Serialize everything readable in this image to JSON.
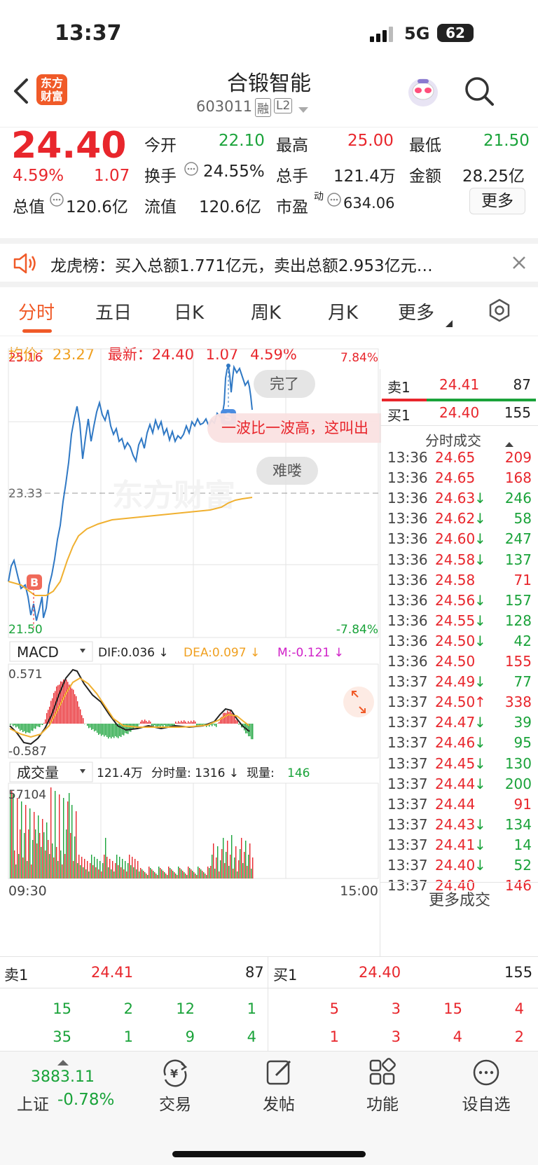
{
  "status": {
    "time": "13:37",
    "network": "5G",
    "battery": "62"
  },
  "header": {
    "title": "合锻智能",
    "code": "603011",
    "badge_margin": "融",
    "badge_level": "L2",
    "logo": "东方财富"
  },
  "quote": {
    "price": "24.40",
    "change_pct": "4.59%",
    "change": "1.07",
    "open_label": "今开",
    "open": "22.10",
    "high_label": "最高",
    "high": "25.00",
    "low_label": "最低",
    "low": "21.50",
    "turnover_label": "换手",
    "turnover": "24.55%",
    "volume_label": "总手",
    "volume": "121.4万",
    "amount_label": "金额",
    "amount": "28.25亿",
    "mcap_label": "总值",
    "mcap": "120.6亿",
    "float_label": "流值",
    "float": "120.6亿",
    "pe_label": "市盈",
    "pe_sup": "动",
    "pe": "634.06",
    "more": "更多"
  },
  "banner": {
    "text": "龙虎榜：买入总额1.771亿元，卖出总额2.953亿元…"
  },
  "tabs": [
    "分时",
    "五日",
    "日K",
    "周K",
    "月K",
    "更多"
  ],
  "chart": {
    "avg_label": "均价：",
    "avg": "23.27",
    "latest_label": "最新：",
    "latest": "24.40",
    "chg": "1.07",
    "pct": "4.59%",
    "y_top": "25.16",
    "y_mid": "23.33",
    "y_bot": "21.50",
    "pct_top": "7.84%",
    "pct_bot": "-7.84%",
    "start": "09:30",
    "end": "15:00",
    "bubble_1": "完了",
    "bubble_2": "一波比一波高，这叫出",
    "bubble_3": "难喽",
    "watermark": "东方财富",
    "macd_label": "MACD",
    "dif": "DIF:0.036 ↓",
    "dea": "DEA:0.097 ↓",
    "m": "M:-0.121 ↓",
    "macd_top": "0.571",
    "macd_bot": "-0.587",
    "vol_label": "成交量",
    "vol_total": "121.4万",
    "vol_min": "分时量: 1316 ↓",
    "vol_now_label": "现量:",
    "vol_now": "146",
    "vol_top": "57104"
  },
  "book_top": {
    "ask_label": "卖1",
    "ask": "24.41",
    "ask_vol": "87",
    "bid_label": "买1",
    "bid": "24.40",
    "bid_vol": "155"
  },
  "ticks_title": "分时成交",
  "ticks": [
    {
      "t": "13:36",
      "p": "24.65",
      "v": "209",
      "d": ""
    },
    {
      "t": "13:36",
      "p": "24.65",
      "v": "168",
      "d": ""
    },
    {
      "t": "13:36",
      "p": "24.63",
      "v": "246",
      "d": "↓"
    },
    {
      "t": "13:36",
      "p": "24.62",
      "v": "58",
      "d": "↓"
    },
    {
      "t": "13:36",
      "p": "24.60",
      "v": "247",
      "d": "↓"
    },
    {
      "t": "13:36",
      "p": "24.58",
      "v": "137",
      "d": "↓"
    },
    {
      "t": "13:36",
      "p": "24.58",
      "v": "71",
      "d": ""
    },
    {
      "t": "13:36",
      "p": "24.56",
      "v": "157",
      "d": "↓"
    },
    {
      "t": "13:36",
      "p": "24.55",
      "v": "128",
      "d": "↓"
    },
    {
      "t": "13:36",
      "p": "24.50",
      "v": "42",
      "d": "↓"
    },
    {
      "t": "13:36",
      "p": "24.50",
      "v": "155",
      "d": ""
    },
    {
      "t": "13:37",
      "p": "24.49",
      "v": "77",
      "d": "↓"
    },
    {
      "t": "13:37",
      "p": "24.50",
      "v": "338",
      "d": "↑"
    },
    {
      "t": "13:37",
      "p": "24.47",
      "v": "39",
      "d": "↓"
    },
    {
      "t": "13:37",
      "p": "24.46",
      "v": "95",
      "d": "↓"
    },
    {
      "t": "13:37",
      "p": "24.45",
      "v": "130",
      "d": "↓"
    },
    {
      "t": "13:37",
      "p": "24.44",
      "v": "200",
      "d": "↓"
    },
    {
      "t": "13:37",
      "p": "24.44",
      "v": "91",
      "d": ""
    },
    {
      "t": "13:37",
      "p": "24.43",
      "v": "134",
      "d": "↓"
    },
    {
      "t": "13:37",
      "p": "24.41",
      "v": "14",
      "d": "↓"
    },
    {
      "t": "13:37",
      "p": "24.40",
      "v": "52",
      "d": "↓"
    },
    {
      "t": "13:37",
      "p": "24.40",
      "v": "146",
      "d": ""
    }
  ],
  "more_ticks": "更多成交",
  "book": {
    "ask_label": "卖1",
    "ask": "24.41",
    "ask_vol": "87",
    "bid_label": "买1",
    "bid": "24.40",
    "bid_vol": "155",
    "ask_row1": [
      "15",
      "2",
      "12",
      "1"
    ],
    "ask_row2": [
      "35",
      "1",
      "9",
      "4"
    ],
    "bid_row1": [
      "5",
      "3",
      "15",
      "4"
    ],
    "bid_row2": [
      "1",
      "3",
      "4",
      "2"
    ]
  },
  "bottom": {
    "index_value": "3883.11",
    "index_name": "上证",
    "index_pct": "-0.78%",
    "trade": "交易",
    "post": "发帖",
    "func": "功能",
    "watch": "设自选"
  }
}
